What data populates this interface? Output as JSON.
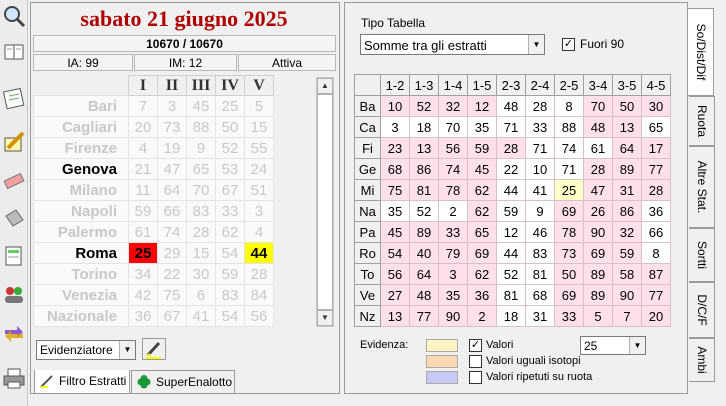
{
  "header": {
    "date_title": "sabato 21 giugno 2025",
    "ratio": "10670 / 10670",
    "ia": "IA: 99",
    "im": "IM: 12",
    "status": "Attiva"
  },
  "estratti": {
    "columns": [
      "I",
      "II",
      "III",
      "IV",
      "V"
    ],
    "rows": [
      {
        "city": "Bari",
        "values": [
          "7",
          "3",
          "45",
          "25",
          "5"
        ]
      },
      {
        "city": "Cagliari",
        "values": [
          "20",
          "73",
          "88",
          "50",
          "15"
        ]
      },
      {
        "city": "Firenze",
        "values": [
          "4",
          "19",
          "9",
          "52",
          "55"
        ]
      },
      {
        "city": "Genova",
        "values": [
          "21",
          "47",
          "65",
          "53",
          "24"
        ]
      },
      {
        "city": "Milano",
        "values": [
          "11",
          "64",
          "70",
          "67",
          "51"
        ]
      },
      {
        "city": "Napoli",
        "values": [
          "59",
          "66",
          "83",
          "33",
          "3"
        ]
      },
      {
        "city": "Palermo",
        "values": [
          "61",
          "74",
          "28",
          "62",
          "4"
        ]
      },
      {
        "city": "Roma",
        "values": [
          "25",
          "29",
          "15",
          "54",
          "44"
        ]
      },
      {
        "city": "Torino",
        "values": [
          "34",
          "22",
          "30",
          "59",
          "28"
        ]
      },
      {
        "city": "Venezia",
        "values": [
          "42",
          "75",
          "6",
          "83",
          "84"
        ]
      },
      {
        "city": "Nazionale",
        "values": [
          "36",
          "67",
          "41",
          "54",
          "56"
        ]
      }
    ]
  },
  "evidenziatore": {
    "selected": "Evidenziatore"
  },
  "bottom_tabs": [
    {
      "label": "Filtro Estratti"
    },
    {
      "label": "SuperEnalotto"
    }
  ],
  "tipo_tabella": {
    "label": "Tipo Tabella",
    "selected": "Somme tra gli estratti",
    "fuori90_label": "Fuori 90",
    "fuori90_checked": "✓"
  },
  "matrix": {
    "columns": [
      "1-2",
      "1-3",
      "1-4",
      "1-5",
      "2-3",
      "2-4",
      "2-5",
      "3-4",
      "3-5",
      "4-5"
    ],
    "rows": [
      {
        "label": "Ba",
        "values": [
          "10",
          "52",
          "32",
          "12",
          "48",
          "28",
          "8",
          "70",
          "50",
          "30"
        ]
      },
      {
        "label": "Ca",
        "values": [
          "3",
          "18",
          "70",
          "35",
          "71",
          "33",
          "88",
          "48",
          "13",
          "65"
        ]
      },
      {
        "label": "Fi",
        "values": [
          "23",
          "13",
          "56",
          "59",
          "28",
          "71",
          "74",
          "61",
          "64",
          "17"
        ]
      },
      {
        "label": "Ge",
        "values": [
          "68",
          "86",
          "74",
          "45",
          "22",
          "10",
          "71",
          "28",
          "89",
          "77"
        ]
      },
      {
        "label": "Mi",
        "values": [
          "75",
          "81",
          "78",
          "62",
          "44",
          "41",
          "25",
          "47",
          "31",
          "28"
        ]
      },
      {
        "label": "Na",
        "values": [
          "35",
          "52",
          "2",
          "62",
          "59",
          "9",
          "69",
          "26",
          "86",
          "36"
        ]
      },
      {
        "label": "Pa",
        "values": [
          "45",
          "89",
          "33",
          "65",
          "12",
          "46",
          "78",
          "90",
          "32",
          "66"
        ]
      },
      {
        "label": "Ro",
        "values": [
          "54",
          "40",
          "79",
          "69",
          "44",
          "83",
          "73",
          "69",
          "59",
          "8"
        ]
      },
      {
        "label": "To",
        "values": [
          "56",
          "64",
          "3",
          "62",
          "52",
          "81",
          "50",
          "89",
          "58",
          "87"
        ]
      },
      {
        "label": "Ve",
        "values": [
          "27",
          "48",
          "35",
          "36",
          "81",
          "68",
          "69",
          "89",
          "90",
          "77"
        ]
      },
      {
        "label": "Nz",
        "values": [
          "13",
          "77",
          "90",
          "2",
          "18",
          "31",
          "33",
          "5",
          "7",
          "20"
        ]
      }
    ]
  },
  "evidenza": {
    "label": "Evidenza:",
    "valori_label": "Valori",
    "valori_checked": "✓",
    "valori_value": "25",
    "isotopi_label": "Valori uguali isotopi",
    "ripetuti_label": "Valori ripetuti su ruota"
  },
  "right_tabs": [
    {
      "label": "So/Dist/Dif"
    },
    {
      "label": "Ruota"
    },
    {
      "label": "Altre Stat."
    },
    {
      "label": "Sortti"
    },
    {
      "label": "D/C/F"
    },
    {
      "label": "Ambi"
    }
  ],
  "colors": {
    "title_red": "#b00000",
    "highlight_red": "#ff0000",
    "highlight_yellow": "#ffff00",
    "matrix_pink": "#fde0ea",
    "matrix_yellow": "#ffffc8",
    "swatch_yellow": "#fff4c4",
    "swatch_peach": "#ffd8b4",
    "swatch_lavender": "#c8c8f4"
  }
}
